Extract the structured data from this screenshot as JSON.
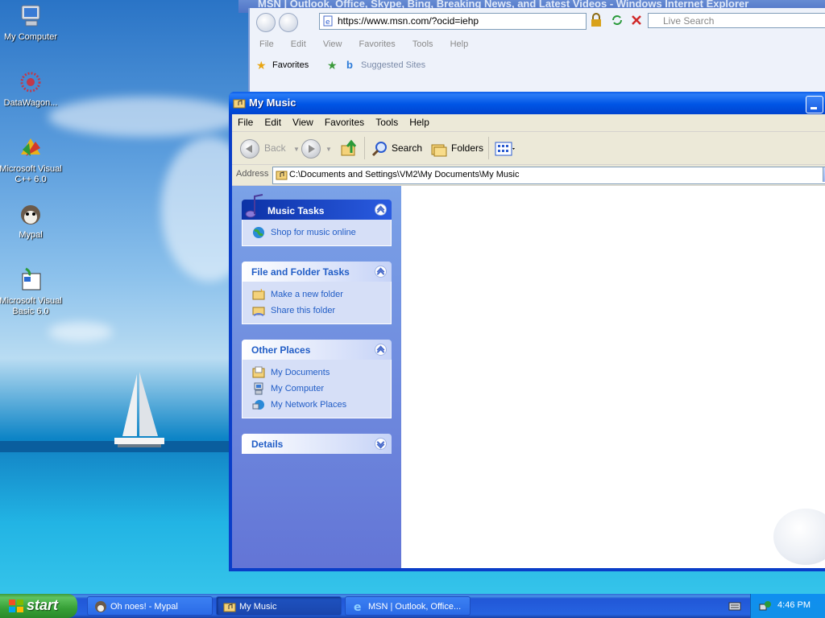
{
  "desktop": {
    "icons": [
      {
        "label": "My Computer"
      },
      {
        "label": "DataWagon..."
      },
      {
        "label": "Microsoft Visual C++ 6.0"
      },
      {
        "label": "Mypal"
      },
      {
        "label": "Microsoft Visual Basic 6.0"
      }
    ]
  },
  "ie_window": {
    "title": "MSN | Outlook, Office, Skype, Bing, Breaking News, and Latest Videos - Windows Internet Explorer",
    "address": "https://www.msn.com/?ocid=iehp",
    "search_placeholder": "Live Search",
    "menu": [
      "File",
      "Edit",
      "View",
      "Favorites",
      "Tools",
      "Help"
    ],
    "favorites_label": "Favorites",
    "suggested_sites": "Suggested Sites"
  },
  "window": {
    "title": "My Music",
    "menu": [
      "File",
      "Edit",
      "View",
      "Favorites",
      "Tools",
      "Help"
    ],
    "toolbar": {
      "back": "Back",
      "search": "Search",
      "folders": "Folders"
    },
    "address_label": "Address",
    "address": "C:\\Documents and Settings\\VM2\\My Documents\\My Music"
  },
  "taskpane": {
    "music_tasks": {
      "title": "Music Tasks",
      "links": [
        "Shop for music online"
      ]
    },
    "file_folder_tasks": {
      "title": "File and Folder Tasks",
      "links": [
        "Make a new folder",
        "Share this folder"
      ]
    },
    "other_places": {
      "title": "Other Places",
      "links": [
        "My Documents",
        "My Computer",
        "My Network Places"
      ]
    },
    "details": {
      "title": "Details"
    }
  },
  "taskbar": {
    "start": "start",
    "buttons": [
      "Oh noes! - Mypal",
      "My Music",
      "MSN | Outlook, Office..."
    ],
    "clock": "4:46 PM"
  }
}
